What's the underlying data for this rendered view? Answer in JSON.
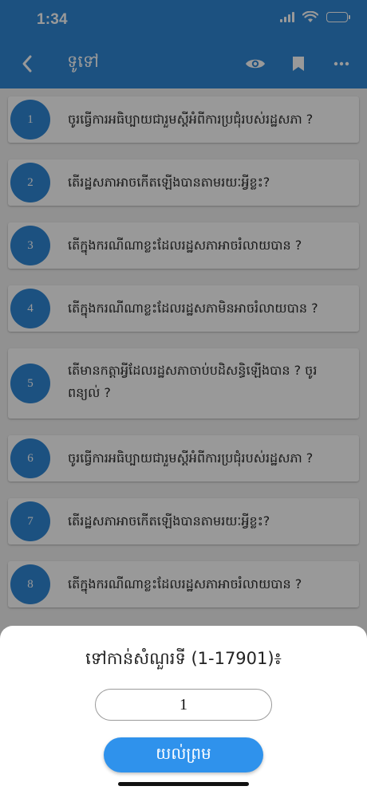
{
  "status_bar": {
    "time": "1:34"
  },
  "nav": {
    "back_icon": "chevron-left-icon",
    "title": "ទូទៅ",
    "actions": [
      "eye-icon",
      "bookmark-icon",
      "more-horizontal-icon"
    ]
  },
  "questions": [
    {
      "number": "1",
      "text": "ចូរធ្វើការអធិប្បាយជារួមស្តីអំពីការប្រជុំរបស់រដ្ឋសភា ?"
    },
    {
      "number": "2",
      "text": "តើរដ្ឋសភាអាចកើតឡើងបានតាមរយៈអ្វីខ្លះ?"
    },
    {
      "number": "3",
      "text": "តើក្នុងករណីណាខ្លះដែលរដ្ឋសភាអាចរំលាយបាន ?"
    },
    {
      "number": "4",
      "text": "តើក្នុងករណីណាខ្លះដែលរដ្ឋសភាមិនអាចរំលាយបាន ?"
    },
    {
      "number": "5",
      "text": "តើមានកត្តាអ្វីដែលរដ្ឋសភាចាប់បដិសន្ធិឡើងបាន ? ចូរពន្យល់ ?"
    },
    {
      "number": "6",
      "text": "ចូរធ្វើការអធិប្បាយជារួមស្តីអំពីការប្រជុំរបស់រដ្ឋសភា ?"
    },
    {
      "number": "7",
      "text": "តើរដ្ឋសភាអាចកើតឡើងបានតាមរយៈអ្វីខ្លះ?"
    },
    {
      "number": "8",
      "text": "តើក្នុងករណីណាខ្លះដែលរដ្ឋសភាអាចរំលាយបាន ?"
    }
  ],
  "dialog": {
    "title": "ទៅកាន់សំណួរទី (1-17901)៖",
    "input_value": "1",
    "ok_label": "យល់ព្រម"
  },
  "colors": {
    "primary": "#2f87d6",
    "button": "#2f92ec"
  }
}
